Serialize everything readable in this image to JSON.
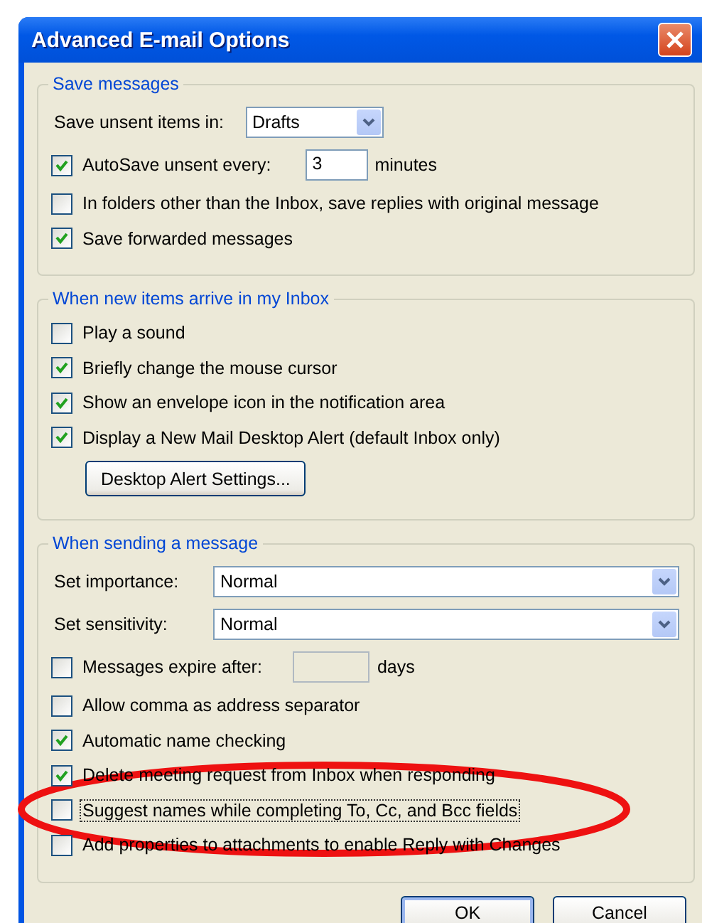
{
  "window": {
    "title": "Advanced E-mail Options"
  },
  "groups": [
    {
      "legend": "Save messages",
      "rows": [
        {
          "kind": "dropdown_inline",
          "label": "Save unsent items in:",
          "value": "Drafts"
        },
        {
          "kind": "checkbox_input",
          "label": "AutoSave unsent every:",
          "checked": true,
          "focused": false,
          "value": "3",
          "unit": "minutes",
          "disabled": false
        },
        {
          "kind": "checkbox",
          "label": "In folders other than the Inbox, save replies with original message",
          "checked": false,
          "focused": false
        },
        {
          "kind": "checkbox",
          "label": "Save forwarded messages",
          "checked": true,
          "focused": false
        }
      ]
    },
    {
      "legend": "When new items arrive in my Inbox",
      "rows": [
        {
          "kind": "checkbox",
          "label": "Play a sound",
          "checked": false,
          "focused": false
        },
        {
          "kind": "checkbox",
          "label": "Briefly change the mouse cursor",
          "checked": true,
          "focused": false
        },
        {
          "kind": "checkbox",
          "label": "Show an envelope icon in the notification area",
          "checked": true,
          "focused": false
        },
        {
          "kind": "checkbox",
          "label": "Display a New Mail Desktop Alert (default Inbox only)",
          "checked": true,
          "focused": false
        },
        {
          "kind": "button",
          "label": "Desktop Alert Settings..."
        }
      ]
    },
    {
      "legend": "When sending a message",
      "rows": [
        {
          "kind": "dropdown_full",
          "label": "Set importance:",
          "value": "Normal"
        },
        {
          "kind": "dropdown_full",
          "label": "Set sensitivity:",
          "value": "Normal"
        },
        {
          "kind": "checkbox_input",
          "label": "Messages expire after:",
          "checked": false,
          "focused": false,
          "unit": "days",
          "disabled": true
        },
        {
          "kind": "checkbox",
          "label": "Allow comma as address separator",
          "checked": false,
          "focused": false
        },
        {
          "kind": "checkbox",
          "label": "Automatic name checking",
          "checked": true,
          "focused": false
        },
        {
          "kind": "checkbox",
          "label": "Delete meeting request from Inbox when responding",
          "checked": true,
          "focused": false
        },
        {
          "kind": "checkbox",
          "label": "Suggest names while completing To, Cc, and Bcc fields",
          "checked": false,
          "focused": true
        },
        {
          "kind": "checkbox",
          "label": "Add properties to attachments to enable Reply with Changes",
          "checked": false,
          "focused": false
        }
      ]
    }
  ],
  "buttons": [
    {
      "label": "OK",
      "default": true
    },
    {
      "label": "Cancel",
      "default": false
    }
  ],
  "annotation": {
    "kind": "ellipse"
  }
}
